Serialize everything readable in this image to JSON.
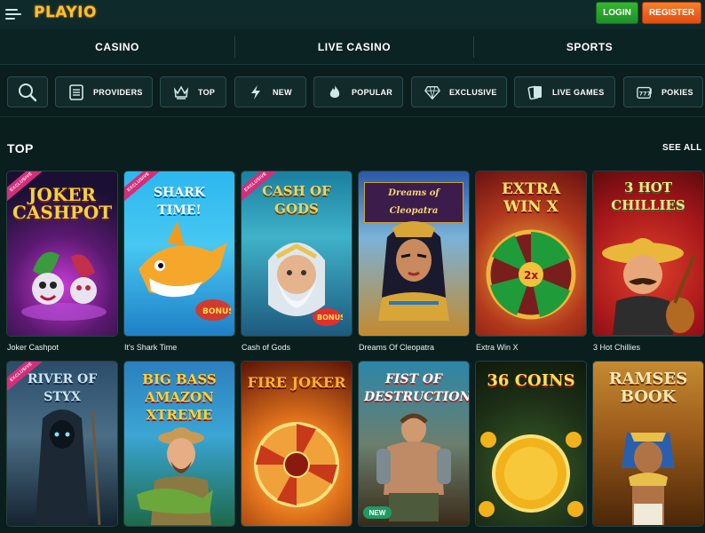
{
  "header": {
    "logo": "PLAYIO",
    "login_label": "LOGIN",
    "register_label": "REGISTER",
    "menu_icon": "hamburger-icon"
  },
  "nav": {
    "tabs": [
      "CASINO",
      "LIVE CASINO",
      "SPORTS"
    ]
  },
  "categories": [
    {
      "label": "",
      "icon": "search-icon"
    },
    {
      "label": "PROVIDERS",
      "icon": "providers-icon"
    },
    {
      "label": "TOP",
      "icon": "crown-icon"
    },
    {
      "label": "NEW",
      "icon": "lightning-icon"
    },
    {
      "label": "POPULAR",
      "icon": "flame-icon"
    },
    {
      "label": "EXCLUSIVE",
      "icon": "diamond-icon"
    },
    {
      "label": "LIVE GAMES",
      "icon": "cards-icon"
    },
    {
      "label": "POKIES",
      "icon": "slot-machine-icon"
    }
  ],
  "section": {
    "title": "TOP",
    "see_all": "SEE ALL"
  },
  "games": [
    {
      "name": "Joker Cashpot",
      "art_text": "JOKER\nCASHPOT",
      "badge": "EXCLUSIVE"
    },
    {
      "name": "It's Shark Time",
      "art_text": "SHARK TIME!",
      "badge": "EXCLUSIVE"
    },
    {
      "name": "Cash of Gods",
      "art_text": "CASH OF GODS",
      "badge": "EXCLUSIVE"
    },
    {
      "name": "Dreams Of Cleopatra",
      "art_text": "Dreams of Cleopatra",
      "badge": ""
    },
    {
      "name": "Extra Win X",
      "art_text": "EXTRA WIN X",
      "badge": ""
    },
    {
      "name": "3 Hot Chillies",
      "art_text": "3 HOT CHILLIES",
      "badge": ""
    },
    {
      "name": "",
      "art_text": "RIVER OF STYX",
      "badge": "EXCLUSIVE"
    },
    {
      "name": "",
      "art_text": "BIG BASS AMAZON XTREME",
      "badge": ""
    },
    {
      "name": "",
      "art_text": "FIRE JOKER",
      "badge": ""
    },
    {
      "name": "",
      "art_text": "FIST OF DESTRUCTION",
      "badge": "NEW"
    },
    {
      "name": "",
      "art_text": "36 COINS",
      "badge": ""
    },
    {
      "name": "",
      "art_text": "RAMSES BOOK",
      "badge": ""
    }
  ]
}
